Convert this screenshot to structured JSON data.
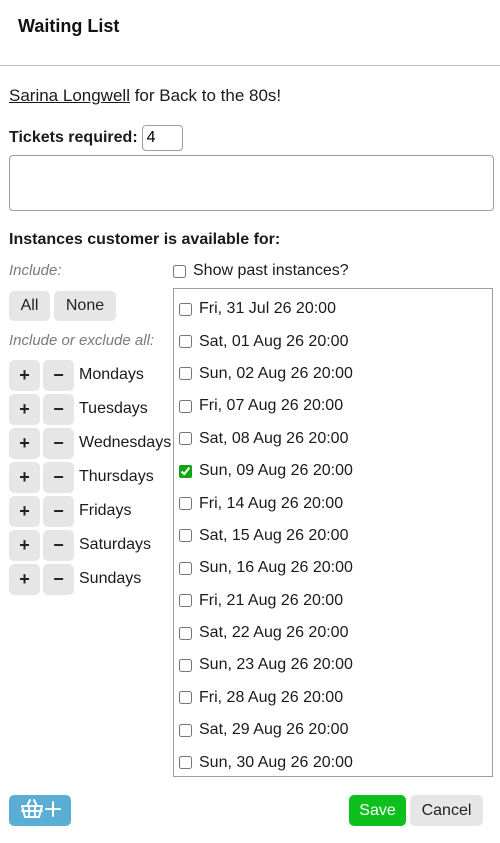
{
  "header": {
    "title": "Waiting List"
  },
  "customer": {
    "name": "Sarina Longwell",
    "suffix": " for Back to the 80s!"
  },
  "tickets": {
    "label": "Tickets required:",
    "value": "4"
  },
  "notes": {
    "value": "",
    "placeholder": ""
  },
  "section_title": "Instances customer is available for:",
  "include_label": "Include:",
  "all_label": "All",
  "none_label": "None",
  "include_exclude_label": "Include or exclude all:",
  "plus_glyph": "+",
  "minus_glyph": "−",
  "days": [
    "Mondays",
    "Tuesdays",
    "Wednesdays",
    "Thursdays",
    "Fridays",
    "Saturdays",
    "Sundays"
  ],
  "show_past": {
    "label": "Show past instances?",
    "checked": false
  },
  "instances": [
    {
      "label": "Fri, 31 Jul 26 20:00",
      "checked": false
    },
    {
      "label": "Sat, 01 Aug 26 20:00",
      "checked": false
    },
    {
      "label": "Sun, 02 Aug 26 20:00",
      "checked": false
    },
    {
      "label": "Fri, 07 Aug 26 20:00",
      "checked": false
    },
    {
      "label": "Sat, 08 Aug 26 20:00",
      "checked": false
    },
    {
      "label": "Sun, 09 Aug 26 20:00",
      "checked": true
    },
    {
      "label": "Fri, 14 Aug 26 20:00",
      "checked": false
    },
    {
      "label": "Sat, 15 Aug 26 20:00",
      "checked": false
    },
    {
      "label": "Sun, 16 Aug 26 20:00",
      "checked": false
    },
    {
      "label": "Fri, 21 Aug 26 20:00",
      "checked": false
    },
    {
      "label": "Sat, 22 Aug 26 20:00",
      "checked": false
    },
    {
      "label": "Sun, 23 Aug 26 20:00",
      "checked": false
    },
    {
      "label": "Fri, 28 Aug 26 20:00",
      "checked": false
    },
    {
      "label": "Sat, 29 Aug 26 20:00",
      "checked": false
    },
    {
      "label": "Sun, 30 Aug 26 20:00",
      "checked": false
    }
  ],
  "footer": {
    "basket_icon": "basket-plus-icon",
    "save_label": "Save",
    "cancel_label": "Cancel"
  },
  "colors": {
    "save": "#0fbf1e",
    "basket": "#5aaed6",
    "check": "#12a512",
    "grey_button": "#e6e6e6"
  }
}
